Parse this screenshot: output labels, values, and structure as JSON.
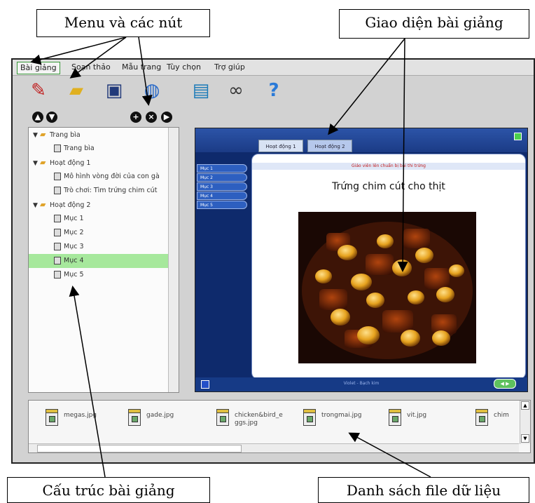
{
  "callouts": {
    "menu": "Menu và các nút",
    "interface": "Giao diện bài giảng",
    "structure": "Cấu trúc bài giảng",
    "files": "Danh sách file dữ liệu"
  },
  "menu": [
    "Bài giảng",
    "Soạn thảo",
    "Mẫu trang",
    "Tùy chọn",
    "Trợ giúp"
  ],
  "toolbar_icons": [
    "pencil-icon",
    "folder-icon",
    "save-icon",
    "globe-icon",
    "monitor-icon",
    "binoculars-icon",
    "help-icon"
  ],
  "tree": {
    "items": [
      {
        "level": 0,
        "type": "folder",
        "label": "Trang bìa"
      },
      {
        "level": 1,
        "type": "page",
        "label": "Trang bìa"
      },
      {
        "level": 0,
        "type": "folder",
        "label": "Hoạt động 1"
      },
      {
        "level": 1,
        "type": "page",
        "label": "Mô hình vòng đời của con gà"
      },
      {
        "level": 1,
        "type": "page",
        "label": "Trò chơi: Tìm trứng chim cút"
      },
      {
        "level": 0,
        "type": "folder",
        "label": "Hoạt động 2"
      },
      {
        "level": 1,
        "type": "page",
        "label": "Mục 1"
      },
      {
        "level": 1,
        "type": "page",
        "label": "Mục 2"
      },
      {
        "level": 1,
        "type": "page",
        "label": "Mục 3"
      },
      {
        "level": 1,
        "type": "page",
        "label": "Mục 4",
        "selected": true
      },
      {
        "level": 1,
        "type": "page",
        "label": "Mục 5"
      }
    ]
  },
  "preview": {
    "tabs": [
      "Hoạt động 1",
      "Hoạt động 2"
    ],
    "side_menu": [
      "Mục 1",
      "Mục 2",
      "Mục 3",
      "Mục 4",
      "Mục 5"
    ],
    "red_header": "Giáo viên lên chuẩn bị bài thi trứng",
    "heading": "Trứng chim cút cho thịt",
    "footer": "Violet - Bạch kim",
    "nav": "◀ ▶"
  },
  "files": [
    {
      "name": "megas.jpg"
    },
    {
      "name": "gade.jpg"
    },
    {
      "name": "chicken&bird_eggs.jpg"
    },
    {
      "name": "trongmai.jpg"
    },
    {
      "name": "vit.jpg"
    },
    {
      "name": "chim"
    }
  ]
}
